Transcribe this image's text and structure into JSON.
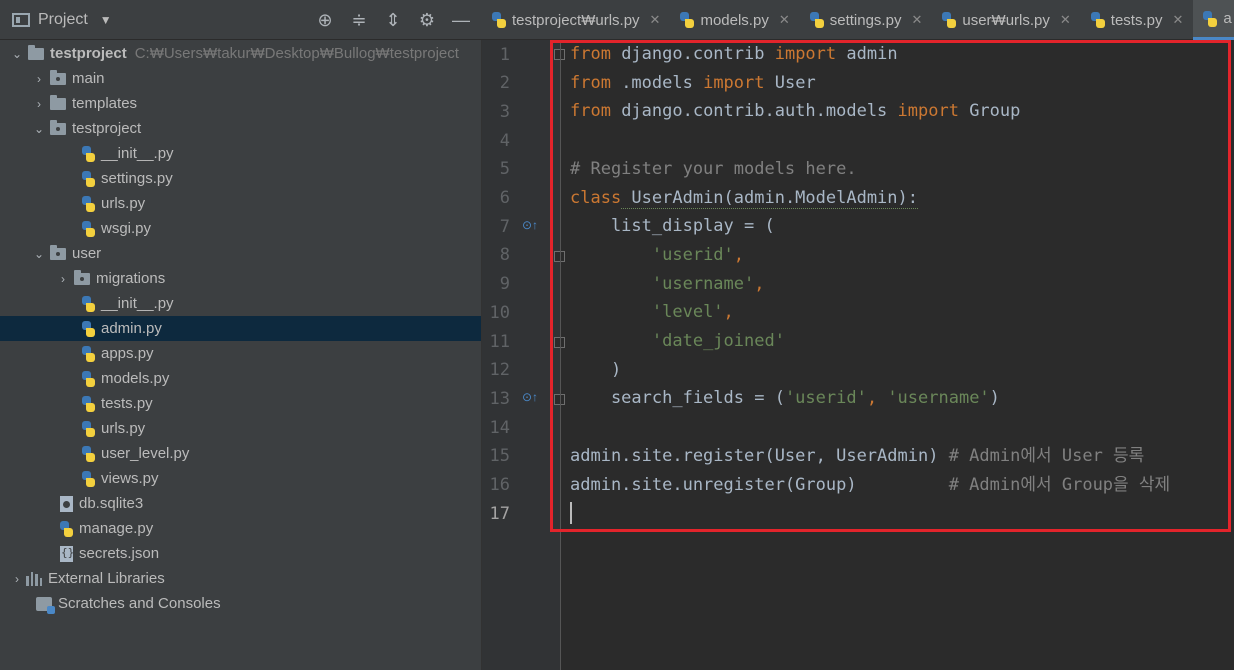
{
  "toolbar": {
    "project_label": "Project",
    "icons": [
      "target-icon",
      "collapse-icon",
      "expand-icon",
      "gear-icon",
      "minimize-icon"
    ]
  },
  "tabs": [
    {
      "label": "testproject₩urls.py",
      "active": false
    },
    {
      "label": "models.py",
      "active": false
    },
    {
      "label": "settings.py",
      "active": false
    },
    {
      "label": "user₩urls.py",
      "active": false
    },
    {
      "label": "tests.py",
      "active": false
    },
    {
      "label": "a",
      "active": true
    }
  ],
  "tree": {
    "root_label": "testproject",
    "root_path": "C:₩Users₩takur₩Desktop₩Bullog₩testproject",
    "main": "main",
    "templates": "templates",
    "testproject": "testproject",
    "tp_init": "__init__.py",
    "tp_settings": "settings.py",
    "tp_urls": "urls.py",
    "tp_wsgi": "wsgi.py",
    "user": "user",
    "migrations": "migrations",
    "u_init": "__init__.py",
    "u_admin": "admin.py",
    "u_apps": "apps.py",
    "u_models": "models.py",
    "u_tests": "tests.py",
    "u_urls": "urls.py",
    "u_user_level": "user_level.py",
    "u_views": "views.py",
    "db": "db.sqlite3",
    "manage": "manage.py",
    "secrets": "secrets.json",
    "external": "External Libraries",
    "scratches": "Scratches and Consoles"
  },
  "editor": {
    "line_numbers": [
      "1",
      "2",
      "3",
      "4",
      "5",
      "6",
      "7",
      "8",
      "9",
      "10",
      "11",
      "12",
      "13",
      "14",
      "15",
      "16",
      "17"
    ],
    "l1": {
      "kw1": "from",
      "mod": " django.contrib ",
      "kw2": "import",
      "name": " admin"
    },
    "l2": {
      "kw1": "from",
      "mod": " .models ",
      "kw2": "import",
      "name": " User"
    },
    "l3": {
      "kw1": "from",
      "mod": " django.contrib.auth.models ",
      "kw2": "import",
      "name": " Group"
    },
    "l5": {
      "comment": "# Register your models here."
    },
    "l6": {
      "kw": "class",
      "rest": " UserAdmin(admin.ModelAdmin):"
    },
    "l7": {
      "text": "    list_display = ("
    },
    "l8": {
      "indent": "        ",
      "str": "'userid'",
      "comma": ","
    },
    "l9": {
      "indent": "        ",
      "str": "'username'",
      "comma": ","
    },
    "l10": {
      "indent": "        ",
      "str": "'level'",
      "comma": ","
    },
    "l11": {
      "indent": "        ",
      "str": "'date_joined'"
    },
    "l12": {
      "text": "    )"
    },
    "l13": {
      "pre": "    search_fields = (",
      "s1": "'userid'",
      "sep": ", ",
      "s2": "'username'",
      "post": ")"
    },
    "l15": {
      "code": "admin.site.register(User, UserAdmin) ",
      "comment": "# Admin에서 User 등록"
    },
    "l16": {
      "code": "admin.site.unregister(Group)         ",
      "comment": "# Admin에서 Group을 삭제"
    }
  }
}
